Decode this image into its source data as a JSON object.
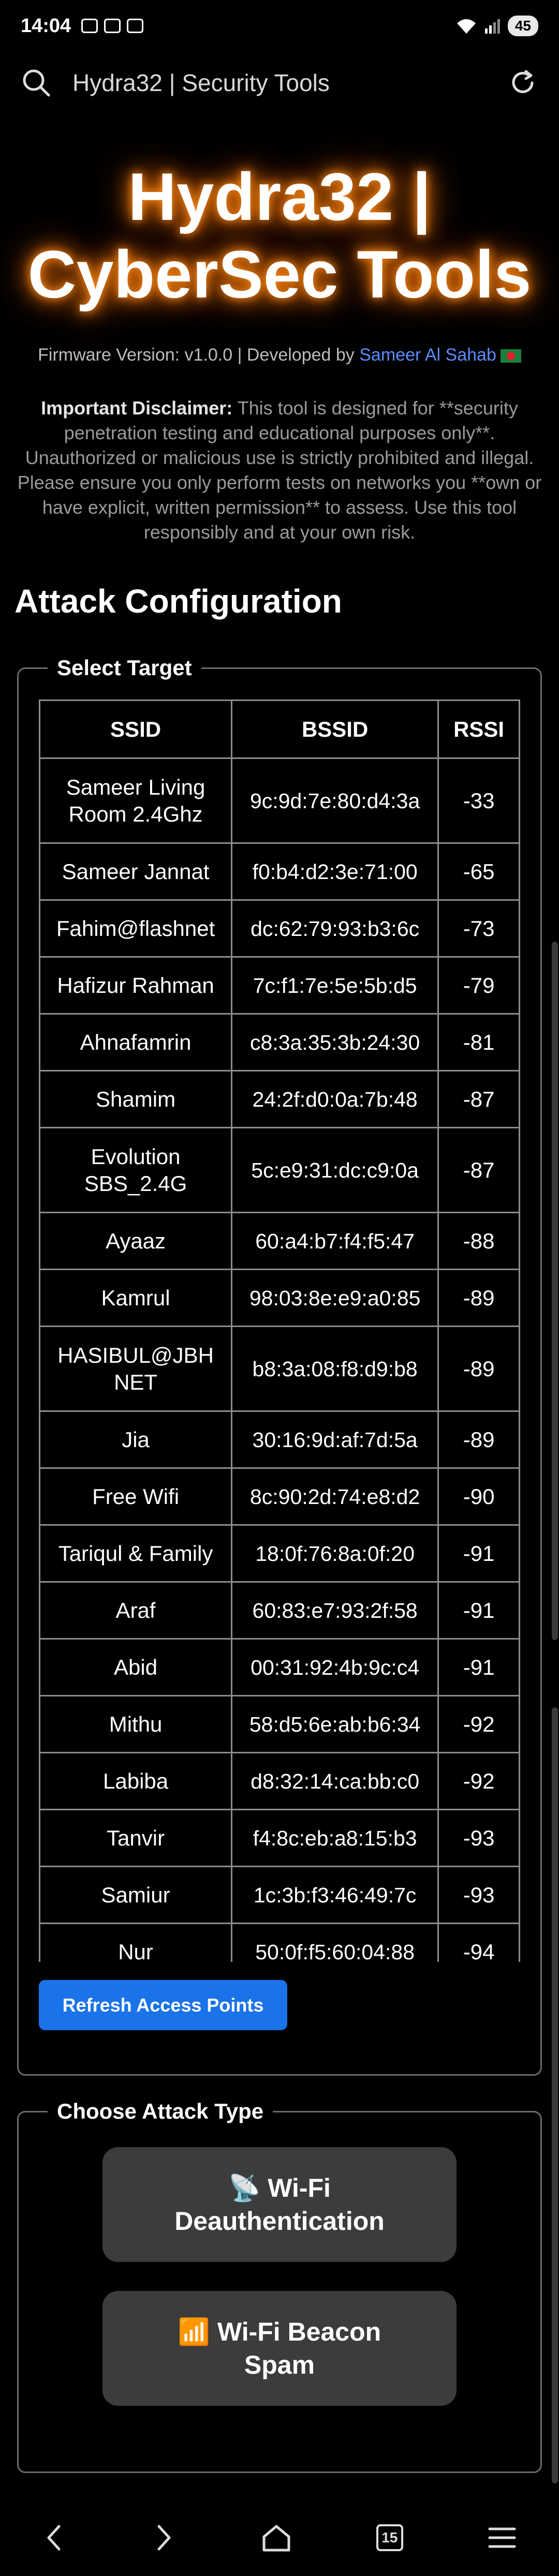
{
  "status": {
    "time": "14:04",
    "battery": "45"
  },
  "browser": {
    "title": "Hydra32 | Security Tools"
  },
  "hero": {
    "title_line1": "Hydra32 |",
    "title_line2": "CyberSec Tools",
    "firmware_prefix": "Firmware Version: v1.0.0 | Developed by ",
    "developer": "Sameer Al Sahab"
  },
  "disclaimer": {
    "label": "Important Disclaimer:",
    "text": " This tool is designed for **security penetration testing and educational purposes only**. Unauthorized or malicious use is strictly prohibited and illegal. Please ensure you only perform tests on networks you **own or have explicit, written permission** to assess. Use this tool responsibly and at your own risk."
  },
  "section_title": "Attack Configuration",
  "target": {
    "legend": "Select Target",
    "headers": [
      "SSID",
      "BSSID",
      "RSSI"
    ],
    "rows": [
      {
        "ssid": "Sameer Living Room 2.4Ghz",
        "bssid": "9c:9d:7e:80:d4:3a",
        "rssi": "-33"
      },
      {
        "ssid": "Sameer Jannat",
        "bssid": "f0:b4:d2:3e:71:00",
        "rssi": "-65"
      },
      {
        "ssid": "Fahim@flashnet",
        "bssid": "dc:62:79:93:b3:6c",
        "rssi": "-73"
      },
      {
        "ssid": "Hafizur Rahman",
        "bssid": "7c:f1:7e:5e:5b:d5",
        "rssi": "-79"
      },
      {
        "ssid": "Ahnafamrin",
        "bssid": "c8:3a:35:3b:24:30",
        "rssi": "-81"
      },
      {
        "ssid": "Shamim",
        "bssid": "24:2f:d0:0a:7b:48",
        "rssi": "-87"
      },
      {
        "ssid": "Evolution SBS_2.4G",
        "bssid": "5c:e9:31:dc:c9:0a",
        "rssi": "-87"
      },
      {
        "ssid": "Ayaaz",
        "bssid": "60:a4:b7:f4:f5:47",
        "rssi": "-88"
      },
      {
        "ssid": "Kamrul",
        "bssid": "98:03:8e:e9:a0:85",
        "rssi": "-89"
      },
      {
        "ssid": "HASIBUL@JBH NET",
        "bssid": "b8:3a:08:f8:d9:b8",
        "rssi": "-89"
      },
      {
        "ssid": "Jia",
        "bssid": "30:16:9d:af:7d:5a",
        "rssi": "-89"
      },
      {
        "ssid": "Free Wifi",
        "bssid": "8c:90:2d:74:e8:d2",
        "rssi": "-90"
      },
      {
        "ssid": "Tariqul & Family",
        "bssid": "18:0f:76:8a:0f:20",
        "rssi": "-91"
      },
      {
        "ssid": "Araf",
        "bssid": "60:83:e7:93:2f:58",
        "rssi": "-91"
      },
      {
        "ssid": "Abid",
        "bssid": "00:31:92:4b:9c:c4",
        "rssi": "-91"
      },
      {
        "ssid": "Mithu",
        "bssid": "58:d5:6e:ab:b6:34",
        "rssi": "-92"
      },
      {
        "ssid": "Labiba",
        "bssid": "d8:32:14:ca:bb:c0",
        "rssi": "-92"
      },
      {
        "ssid": "Tanvir",
        "bssid": "f4:8c:eb:a8:15:b3",
        "rssi": "-93"
      },
      {
        "ssid": "Samiur",
        "bssid": "1c:3b:f3:46:49:7c",
        "rssi": "-93"
      },
      {
        "ssid": "Nur",
        "bssid": "50:0f:f5:60:04:88",
        "rssi": "-94"
      }
    ],
    "refresh_label": "Refresh Access Points"
  },
  "attack": {
    "legend": "Choose Attack Type",
    "deauth_line1": "📡 Wi-Fi",
    "deauth_line2": "Deauthentication",
    "beacon_line1": "📶 Wi-Fi Beacon",
    "beacon_line2": "Spam"
  },
  "nav": {
    "tab_count": "15"
  }
}
